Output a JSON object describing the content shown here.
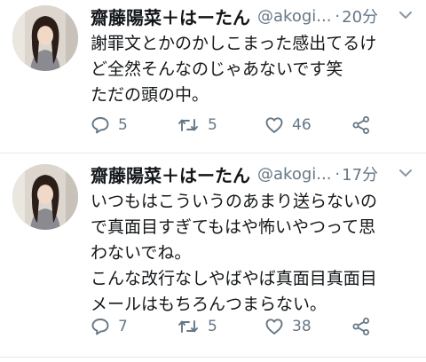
{
  "tweets": [
    {
      "display_name": "齋藤陽菜＋はーたん",
      "handle": "@akogi...",
      "separator": "·",
      "time": "20分",
      "lines": [
        "謝罪文とかのかしこまった感出てるけ",
        "ど全然そんなのじゃあないです笑",
        "ただの頭の中。"
      ],
      "replies": "5",
      "retweets": "5",
      "likes": "46"
    },
    {
      "display_name": "齋藤陽菜＋はーたん",
      "handle": "@akogi...",
      "separator": "·",
      "time": "17分",
      "lines": [
        "いつもはこういうのあまり送らないの",
        "で真面目すぎてもはや怖いやつって思",
        "わないでね。",
        "こんな改行なしやばやば真面目真面目",
        "メールはもちろんつまらない。"
      ],
      "replies": "7",
      "retweets": "5",
      "likes": "38"
    }
  ],
  "icons": {
    "reply": "speech-bubble",
    "retweet": "two-arrows-loop",
    "like": "heart-outline",
    "share": "share-nodes",
    "menu": "chevron-down"
  },
  "colors": {
    "text": "#14171a",
    "muted": "#657786",
    "divider": "#e1e8ed"
  }
}
